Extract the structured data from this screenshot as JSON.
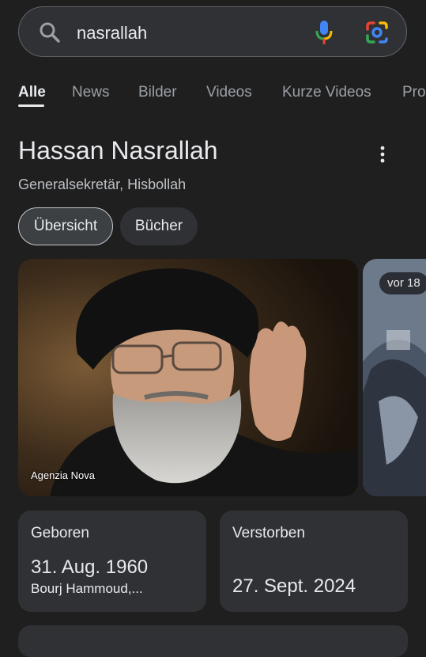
{
  "search": {
    "query": "nasrallah"
  },
  "tabs": [
    {
      "label": "Alle",
      "active": true
    },
    {
      "label": "News"
    },
    {
      "label": "Bilder"
    },
    {
      "label": "Videos"
    },
    {
      "label": "Kurze Videos"
    },
    {
      "label": "Pro"
    }
  ],
  "entity": {
    "title": "Hassan Nasrallah",
    "subtitle": "Generalsekretär, Hisbollah",
    "chips": [
      {
        "label": "Übersicht",
        "selected": true
      },
      {
        "label": "Bücher"
      }
    ]
  },
  "images": {
    "main_source": "Agenzia Nova",
    "side_badge": "vor 18"
  },
  "facts": {
    "born": {
      "label": "Geboren",
      "value": "31. Aug. 1960",
      "detail": "Bourj Hammoud,..."
    },
    "died": {
      "label": "Verstorben",
      "value": "27. Sept. 2024"
    }
  },
  "colors": {
    "background": "#1f1f1f",
    "card": "#303134",
    "google_blue": "#4285f4",
    "google_red": "#ea4335",
    "google_yellow": "#fbbc04",
    "google_green": "#34a853"
  },
  "icons": [
    "search-icon",
    "mic-icon",
    "lens-icon",
    "more-vert-icon"
  ]
}
